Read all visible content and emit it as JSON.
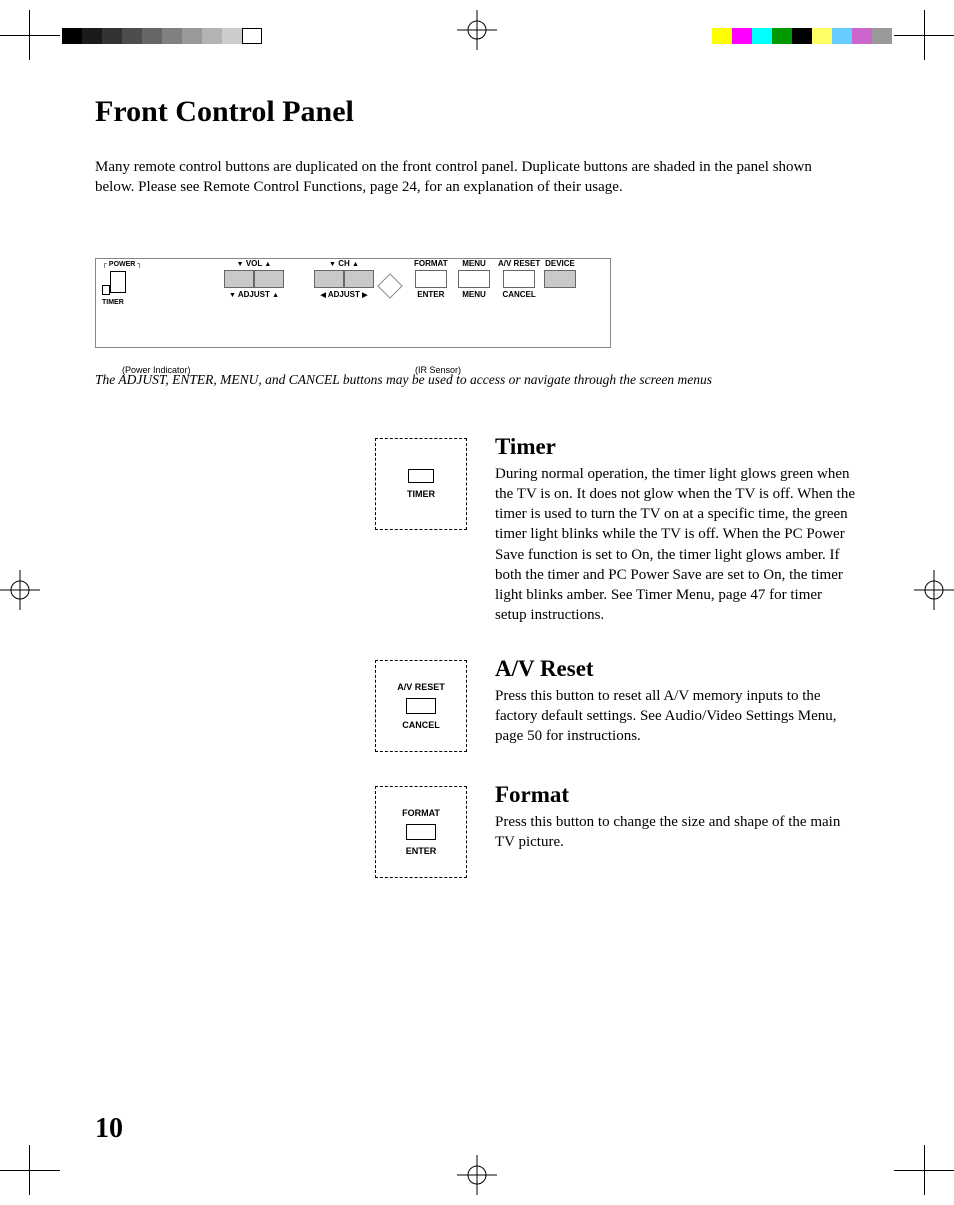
{
  "title": "Front Control Panel",
  "intro": "Many remote control buttons are duplicated on the front control panel.  Duplicate buttons are shaded in the panel shown below.  Please see Remote Control Functions, page 24, for an explanation of their usage.",
  "diagram": {
    "power": "POWER",
    "timer": "TIMER",
    "vol": "VOL",
    "ch": "CH",
    "adjust_v": "ADJUST",
    "adjust_h": "ADJUST",
    "format": "FORMAT",
    "enter": "ENTER",
    "menu": "MENU",
    "menu2": "MENU",
    "av_reset": "A/V RESET",
    "cancel": "CANCEL",
    "device": "DEVICE",
    "power_indicator": "(Power Indicator)",
    "ir_sensor": "(IR Sensor)"
  },
  "caption": "The ADJUST, ENTER, MENU, and CANCEL buttons may be used to access or navigate through the screen menus",
  "sections": [
    {
      "cutout": {
        "top": "",
        "mid": "led",
        "bot": "TIMER"
      },
      "heading": "Timer",
      "body": "During normal operation, the timer light glows green when the TV is on.  It does not glow when the TV is off.  When the timer is used to turn the TV on at a specific time, the green timer light blinks while the TV is off.  When the PC Power Save function is set to On, the timer light glows amber.  If both the timer and PC Power Save are set to On, the timer light blinks amber.  See Timer Menu, page 47 for timer setup instructions."
    },
    {
      "cutout": {
        "top": "A/V RESET",
        "mid": "btn",
        "bot": "CANCEL"
      },
      "heading": "A/V Reset",
      "body": "Press this button to reset all A/V memory inputs to the factory default settings.  See Audio/Video Settings Menu, page 50 for instructions."
    },
    {
      "cutout": {
        "top": "FORMAT",
        "mid": "btn",
        "bot": "ENTER"
      },
      "heading": "Format",
      "body": "Press this button to change the size and shape of the main TV picture."
    }
  ],
  "page_number": "10",
  "gradient_left": [
    "#000000",
    "#1a1a1a",
    "#333333",
    "#4d4d4d",
    "#666666",
    "#808080",
    "#999999",
    "#b3b3b3",
    "#cccccc",
    "#ffffff"
  ],
  "gradient_right": [
    "#ffff00",
    "#ff00ff",
    "#00ffff",
    "#009900",
    "#000000",
    "#ffff66",
    "#66ccff",
    "#cc66cc",
    "#999999"
  ]
}
